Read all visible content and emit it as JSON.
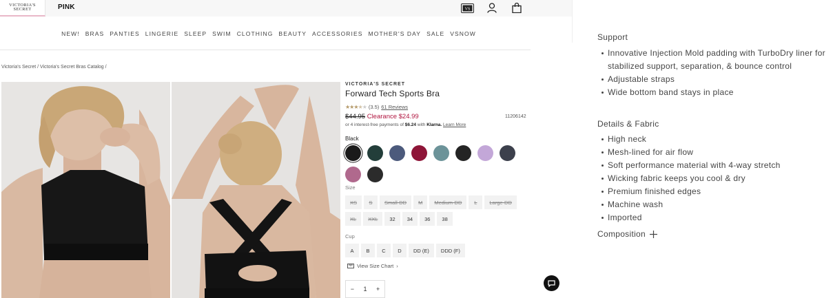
{
  "header": {
    "brand_tab": "VICTORIA'S SECRET",
    "pink_tab": "PINK",
    "icons": [
      "gift-card-icon",
      "account-icon",
      "bag-icon"
    ]
  },
  "nav": {
    "items": [
      "NEW!",
      "BRAS",
      "PANTIES",
      "LINGERIE",
      "SLEEP",
      "SWIM",
      "CLOTHING",
      "BEAUTY",
      "ACCESSORIES",
      "MOTHER'S DAY",
      "SALE",
      "VSNOW"
    ]
  },
  "breadcrumb": "Victoria's Secret / Victoria's Secret Bras Catalog /",
  "product": {
    "brand": "VICTORIA'S SECRET",
    "name": "Forward Tech Sports Bra",
    "rating_text": "(3.5)",
    "reviews": "61 Reviews",
    "original_price": "$44.95",
    "sale_price": "Clearance $24.99",
    "sku": "11206142",
    "klarna_prefix": "or 4 interest-free payments of",
    "klarna_amount": "$6.24",
    "klarna_with": "with",
    "klarna_brand": "Klarna.",
    "klarna_link": "Learn More",
    "color_label": "Black",
    "swatches": [
      "#1a1a1a",
      "#233e3a",
      "#4c5a7c",
      "#8e1538",
      "#6c9399",
      "#242424",
      "#c3a7d8",
      "#3c404c",
      "#b0698d",
      "#2b2b2b"
    ],
    "size_label": "Size",
    "sizes": [
      {
        "label": "XS",
        "available": false
      },
      {
        "label": "S",
        "available": false
      },
      {
        "label": "Small-DD",
        "available": false
      },
      {
        "label": "M",
        "available": false
      },
      {
        "label": "Medium-DD",
        "available": false
      },
      {
        "label": "L",
        "available": false
      },
      {
        "label": "Large-DD",
        "available": false
      },
      {
        "label": "XL",
        "available": false
      },
      {
        "label": "XXL",
        "available": false
      },
      {
        "label": "32",
        "available": true
      },
      {
        "label": "34",
        "available": true
      },
      {
        "label": "36",
        "available": true
      },
      {
        "label": "38",
        "available": true
      }
    ],
    "cup_label": "Cup",
    "cups": [
      "A",
      "B",
      "C",
      "D",
      "DD (E)",
      "DDD (F)"
    ],
    "size_chart_link": "View Size Chart",
    "quantity": "1",
    "qty_minus": "−",
    "qty_plus": "+"
  },
  "details": {
    "support_heading": "Support",
    "support_items": [
      "Innovative Injection Mold padding with TurboDry liner for stabilized support, separation, & bounce control",
      "Adjustable straps",
      "Wide bottom band stays in place"
    ],
    "fabric_heading": "Details & Fabric",
    "fabric_items": [
      "High neck",
      "Mesh-lined for air flow",
      "Soft performance material with 4-way stretch",
      "Wicking fabric keeps you cool & dry",
      "Premium finished edges",
      "Machine wash",
      "Imported"
    ],
    "composition_label": "Composition"
  }
}
